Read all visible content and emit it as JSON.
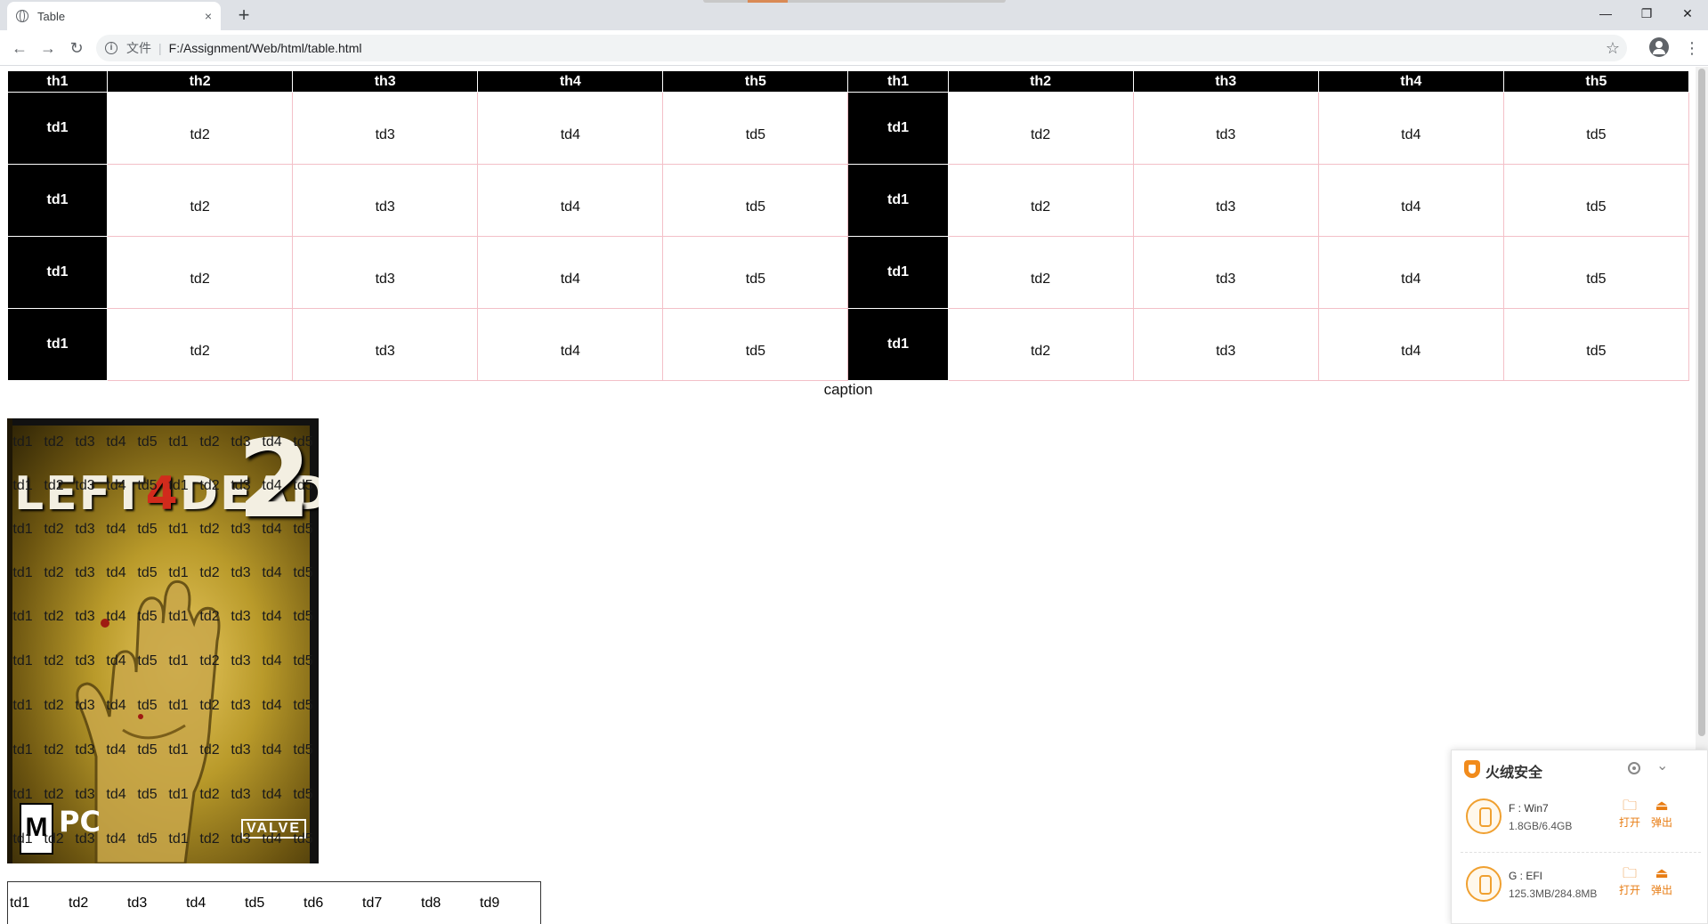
{
  "browser": {
    "tab_title": "Table",
    "tab_close": "×",
    "new_tab": "+",
    "window_controls": [
      "—",
      "❐",
      "✕"
    ],
    "nav": {
      "back": "←",
      "forward": "→",
      "reload": "↻"
    },
    "address": {
      "info": "i",
      "label": "文件",
      "separator": "|",
      "url": "F:/Assignment/Web/html/table.html"
    },
    "star": "☆",
    "menu": "⋮"
  },
  "main_table": {
    "headers": [
      "th1",
      "th2",
      "th3",
      "th4",
      "th5",
      "th1",
      "th2",
      "th3",
      "th4",
      "th5"
    ],
    "rows": [
      [
        "td1",
        "td2",
        "td3",
        "td4",
        "td5",
        "td1",
        "td2",
        "td3",
        "td4",
        "td5"
      ],
      [
        "td1",
        "td2",
        "td3",
        "td4",
        "td5",
        "td1",
        "td2",
        "td3",
        "td4",
        "td5"
      ],
      [
        "td1",
        "td2",
        "td3",
        "td4",
        "td5",
        "td1",
        "td2",
        "td3",
        "td4",
        "td5"
      ],
      [
        "td1",
        "td2",
        "td3",
        "td4",
        "td5",
        "td1",
        "td2",
        "td3",
        "td4",
        "td5"
      ]
    ],
    "caption": "caption"
  },
  "cover": {
    "logo_left": "LEFT",
    "logo_four": "4",
    "logo_right": "DEAD",
    "logo_two": "2",
    "rating": "M",
    "platform": "PC",
    "publisher": "VALVE",
    "overlay_cells": [
      "td1",
      "td2",
      "td3",
      "td4",
      "td5",
      "td1",
      "td2",
      "td3",
      "td4",
      "td5"
    ]
  },
  "bottom_table": {
    "cells": [
      "td1",
      "td2",
      "td3",
      "td4",
      "td5",
      "td6",
      "td7",
      "td8",
      "td9"
    ]
  },
  "security_popup": {
    "title": "火绒安全",
    "collapse": "⌄",
    "drives": [
      {
        "name": "F : Win7",
        "size": "1.8GB/6.4GB",
        "open": "打开",
        "eject": "弹出"
      },
      {
        "name": "G : EFI",
        "size": "125.3MB/284.8MB",
        "open": "打开",
        "eject": "弹出"
      }
    ],
    "accent_color": "#f0a030"
  }
}
